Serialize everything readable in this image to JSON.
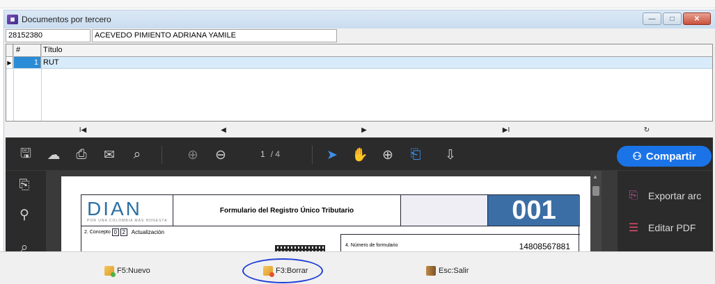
{
  "window": {
    "title": "Documentos por tercero",
    "app_icon": "app-icon",
    "controls": {
      "minimize": "—",
      "maximize": "□",
      "close": "✕"
    }
  },
  "third_party": {
    "id_value": "28152380",
    "name_value": "ACEVEDO PIMIENTO ADRIANA YAMILE"
  },
  "grid": {
    "columns": [
      "#",
      "Título"
    ],
    "rows": [
      {
        "num": "1",
        "title": "RUT",
        "selected": true
      }
    ]
  },
  "navigator": {
    "first": "I◀",
    "prev": "◀",
    "next": "▶",
    "last": "▶I",
    "refresh": "↻"
  },
  "viewer": {
    "page_current": "1",
    "page_total": "/ 4",
    "share_label": "Compartir",
    "right_panel": [
      {
        "label": "Exportar arc",
        "icon": "export-pdf-icon"
      },
      {
        "label": "Editar PDF",
        "icon": "edit-pdf-icon"
      }
    ],
    "document": {
      "logo_text": "DIAN",
      "logo_tagline": "POR UNA COLOMBIA MÁS HONESTA",
      "form_title": "Formulario del Registro Único Tributario",
      "form_code": "001",
      "concepto_label": "2. Concepto",
      "concepto_digits": [
        "0",
        "2"
      ],
      "concepto_value": "Actualización",
      "formnum_label": "4. Número de formulario",
      "formnum_value": "14808567881"
    }
  },
  "statusbar": {
    "new_label": "F5:Nuevo",
    "delete_label": "F3:Borrar",
    "exit_label": "Esc:Salir"
  },
  "colors": {
    "accent": "#1b73e8",
    "selection": "#2a8bd6",
    "highlight_annotation": "#1f3fd6"
  }
}
